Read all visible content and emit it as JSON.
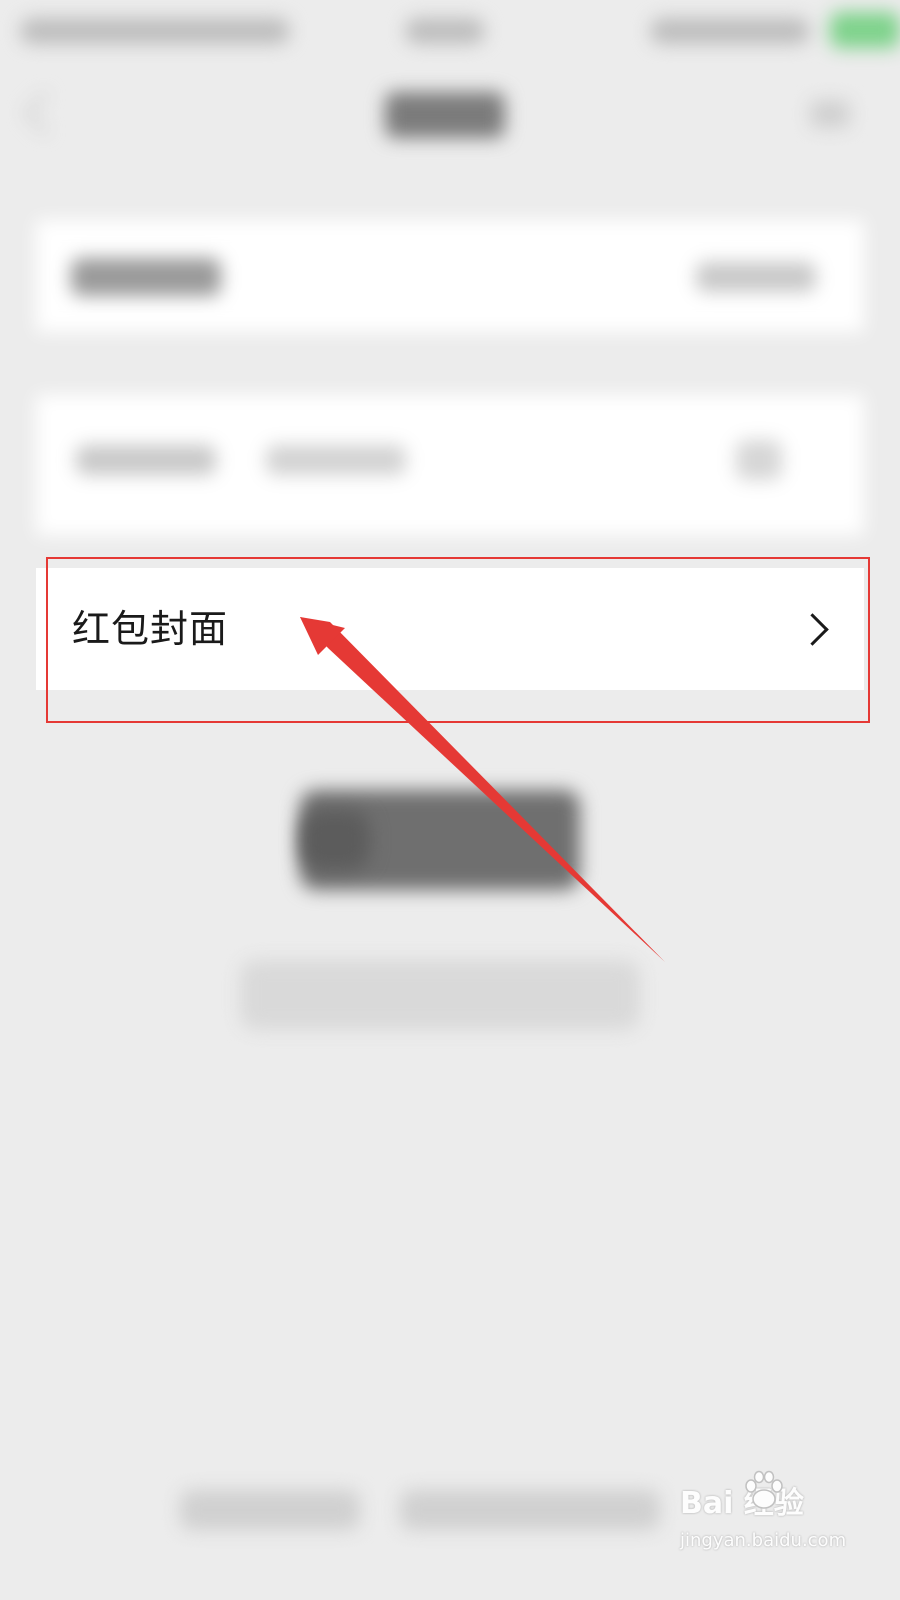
{
  "row": {
    "label": "红包封面"
  },
  "icons": {
    "chevron": "chevron-right-icon",
    "back": "back-icon",
    "more": "more-icon"
  },
  "colors": {
    "annotation": "#e53935",
    "background": "#ececec",
    "card": "#ffffff"
  },
  "watermark": {
    "brand": "Bai  经验",
    "url": "jingyan.baidu.com"
  }
}
